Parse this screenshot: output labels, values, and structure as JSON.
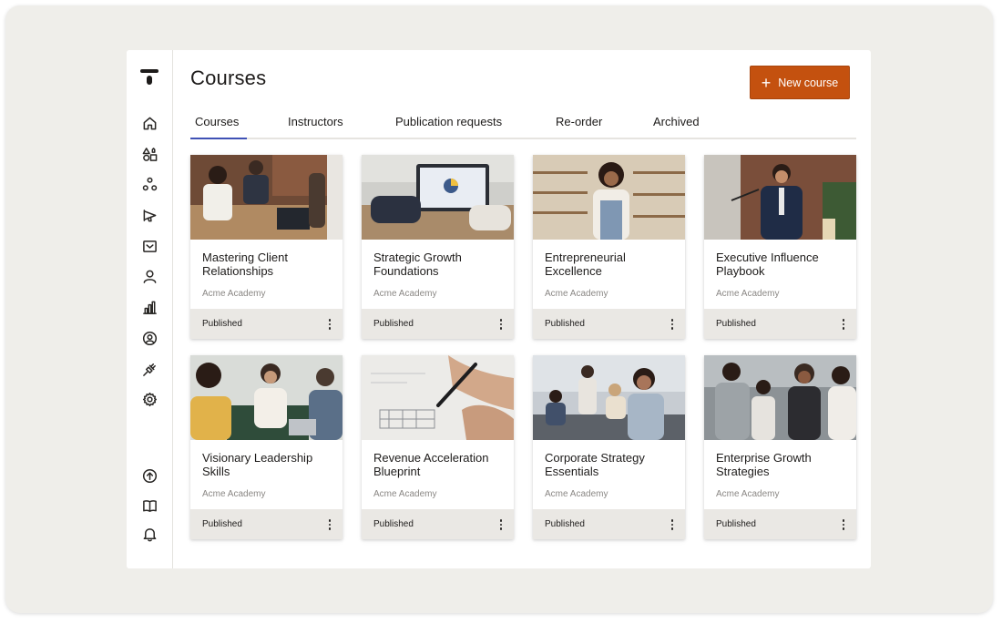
{
  "page": {
    "title": "Courses"
  },
  "header": {
    "new_course_label": "New course"
  },
  "tabs": [
    {
      "label": "Courses",
      "active": true
    },
    {
      "label": "Instructors",
      "active": false
    },
    {
      "label": "Publication requests",
      "active": false
    },
    {
      "label": "Re-order",
      "active": false
    },
    {
      "label": "Archived",
      "active": false
    }
  ],
  "sidebar": {
    "icons": [
      "home-icon",
      "shapes-icon",
      "network-icon",
      "megaphone-icon",
      "inbox-icon",
      "user-icon",
      "bar-chart-icon",
      "account-circle-icon",
      "plug-icon",
      "settings-icon",
      "upload-icon",
      "book-icon",
      "bell-icon"
    ]
  },
  "courses": [
    {
      "title": "Mastering Client Relationships",
      "org": "Acme Academy",
      "status": "Published",
      "image": "meeting-table-photo"
    },
    {
      "title": "Strategic Growth Foundations",
      "org": "Acme Academy",
      "status": "Published",
      "image": "laptop-analytics-photo"
    },
    {
      "title": "Entrepreneurial Excellence",
      "org": "Acme Academy",
      "status": "Published",
      "image": "shop-owner-photo"
    },
    {
      "title": "Executive Influence Playbook",
      "org": "Acme Academy",
      "status": "Published",
      "image": "speaker-podium-photo"
    },
    {
      "title": "Visionary Leadership Skills",
      "org": "Acme Academy",
      "status": "Published",
      "image": "team-discussion-photo"
    },
    {
      "title": "Revenue Acceleration Blueprint",
      "org": "Acme Academy",
      "status": "Published",
      "image": "blueprint-drawing-photo"
    },
    {
      "title": "Corporate Strategy Essentials",
      "org": "Acme Academy",
      "status": "Published",
      "image": "office-meeting-photo"
    },
    {
      "title": "Enterprise Growth Strategies",
      "org": "Acme Academy",
      "status": "Published",
      "image": "colleagues-collab-photo"
    }
  ],
  "colors": {
    "accent": "#c4510f",
    "tab_underline": "#3f51b5",
    "footer_bg": "#eae8e4",
    "frame_bg": "#efeeea"
  }
}
